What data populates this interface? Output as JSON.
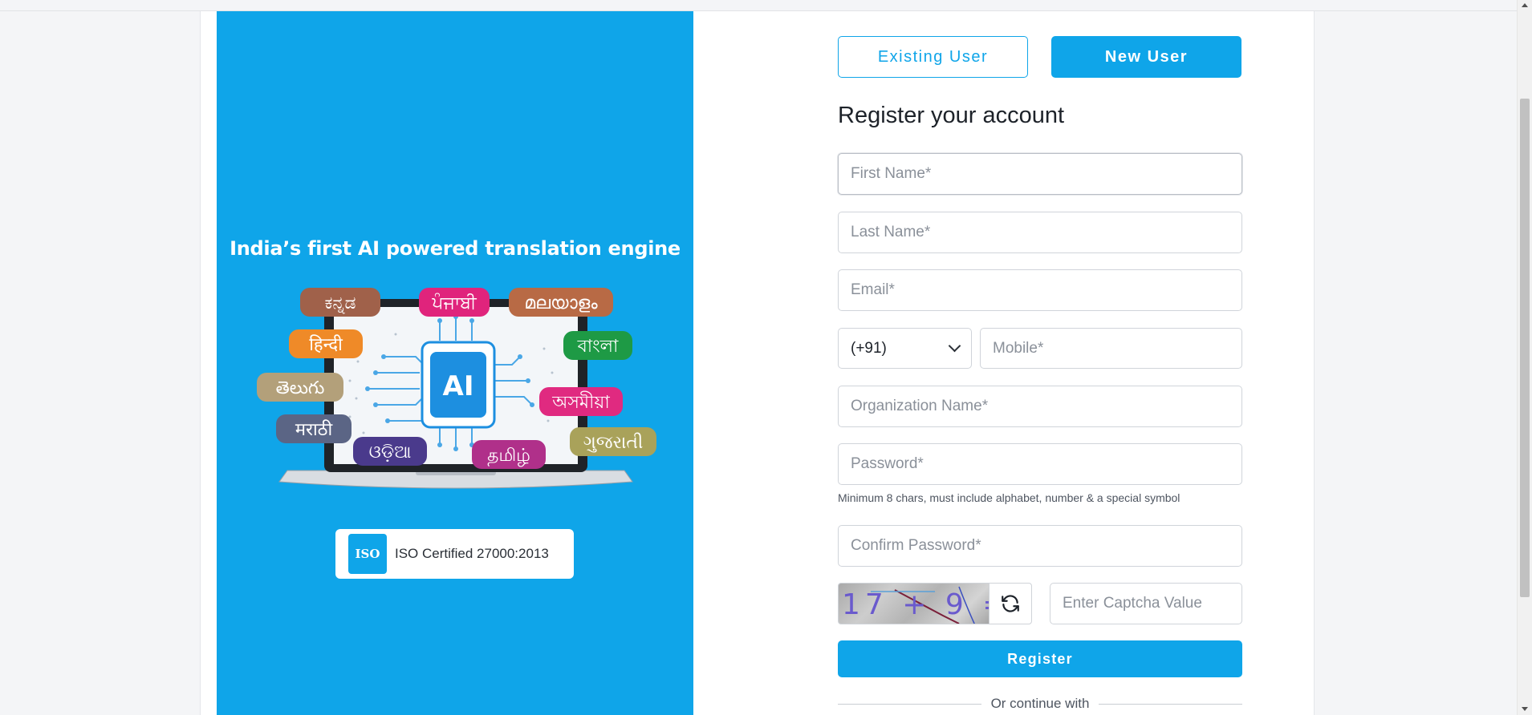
{
  "hero": {
    "title": "India’s first AI powered translation engine",
    "ai_chip_label": "AI",
    "language_tags": [
      {
        "label": "ಕನ್ನಡ",
        "color": "#a0614a"
      },
      {
        "label": "ਪੰਜਾਬੀ",
        "color": "#e0247c"
      },
      {
        "label": "മലയാളം",
        "color": "#b86a45"
      },
      {
        "label": "हिन्दी",
        "color": "#ef8a28"
      },
      {
        "label": "বাংলা",
        "color": "#1e9a45"
      },
      {
        "label": "తెలుగు",
        "color": "#b3a07a"
      },
      {
        "label": "অসমীয়া",
        "color": "#e02a80"
      },
      {
        "label": "मराठी",
        "color": "#5b6585"
      },
      {
        "label": "ଓଡ଼ିଆ",
        "color": "#4a3a8c"
      },
      {
        "label": "தமிழ்",
        "color": "#b0308a"
      },
      {
        "label": "ગુજરાતી",
        "color": "#a9a25a"
      }
    ],
    "iso": {
      "icon_label": "ISO",
      "text": "ISO Certified 27000:2013"
    }
  },
  "tabs": {
    "existing_label": "Existing User",
    "new_label": "New User",
    "active": "New User"
  },
  "form": {
    "title": "Register your account",
    "first_name_placeholder": "First Name*",
    "last_name_placeholder": "Last Name*",
    "email_placeholder": "Email*",
    "country_code": "(+91)",
    "mobile_placeholder": "Mobile*",
    "organization_placeholder": "Organization Name*",
    "password_placeholder": "Password*",
    "password_hint": "Minimum 8 chars, must include alphabet, number & a special symbol",
    "confirm_password_placeholder": "Confirm Password*",
    "captcha_text": "17 + 9 =",
    "captcha_placeholder": "Enter Captcha Value",
    "register_label": "Register",
    "divider_text": "Or continue with"
  },
  "colors": {
    "brand": "#0fa5e9",
    "card": "#ffffff",
    "background": "#f4f5f7"
  }
}
